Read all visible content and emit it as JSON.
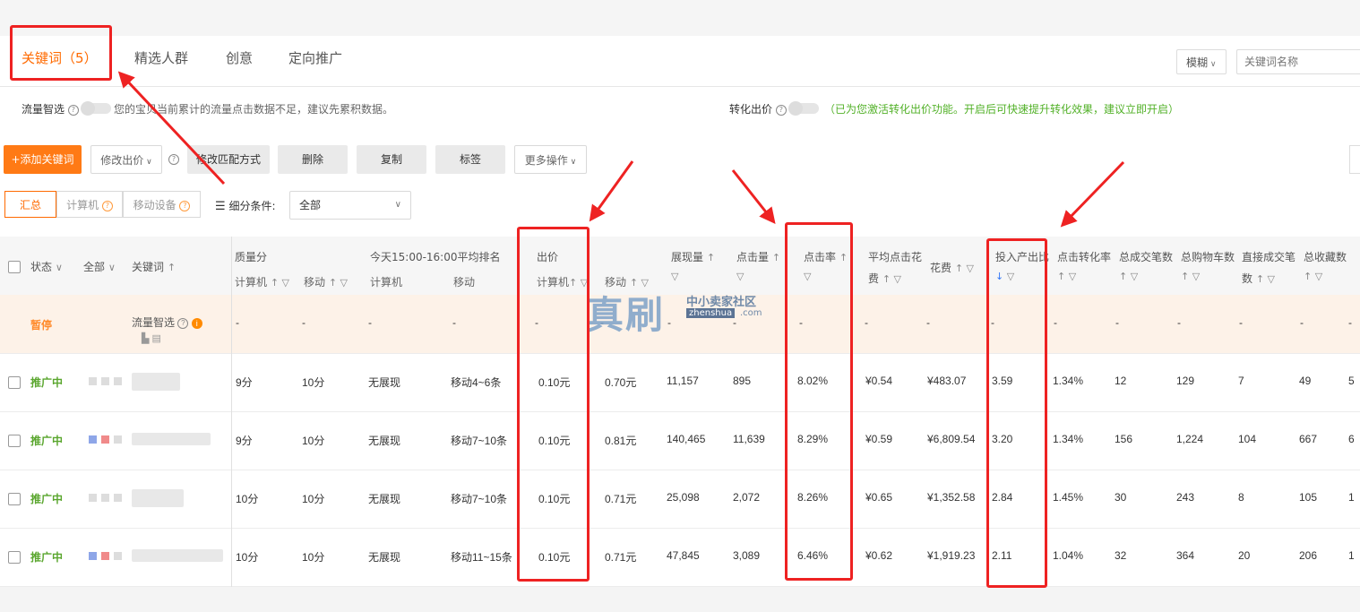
{
  "tabs": {
    "keywords_label": "关键词（",
    "keywords_count": "5",
    "keywords_close": "）",
    "crowd": "精选人群",
    "creative": "创意",
    "targeting": "定向推广"
  },
  "search": {
    "fuzzy": "模糊",
    "placeholder": "关键词名称"
  },
  "flow": {
    "label": "流量智选",
    "message": "您的宝贝当前累计的流量点击数据不足，建议先累积数据。",
    "conv_label": "转化出价",
    "conv_message": "（已为您激活转化出价功能。开启后可快速提升转化效果，建议立即开启）"
  },
  "actions": {
    "add": "+添加关键词",
    "modify_bid": "修改出价",
    "modify_match": "修改匹配方式",
    "delete": "删除",
    "copy": "复制",
    "tag": "标签",
    "more": "更多操作"
  },
  "segments": {
    "summary": "汇总",
    "pc": "计算机",
    "mobile": "移动设备",
    "subdiv_label": "细分条件:",
    "subdiv_value": "全部"
  },
  "headers": {
    "status": "状态",
    "all": "全部",
    "keyword": "关键词",
    "quality": "质量分",
    "pc": "计算机",
    "mobile": "移动",
    "rank": "今天15:00-16:00平均排名",
    "bid": "出价",
    "impressions": "展现量",
    "clicks": "点击量",
    "ctr": "点击率",
    "avg_cpc_1": "平均点击花",
    "avg_cpc_2": "费",
    "spend": "花费",
    "roi": "投入产出比",
    "cvr": "点击转化率",
    "orders": "总成交笔数",
    "cart": "总购物车数",
    "direct_1": "直接成交笔",
    "direct_2": "数",
    "fav": "总收藏数"
  },
  "paused_row": {
    "status": "暂停",
    "keyword": "流量智选",
    "dash": "-"
  },
  "rows": [
    {
      "status": "推广中",
      "quality_pc": "9分",
      "quality_mobile": "10分",
      "rank_pc": "无展现",
      "rank_mobile": "移动4~6条",
      "bid_pc": "0.10元",
      "bid_mobile": "0.70元",
      "impressions": "11,157",
      "clicks": "895",
      "ctr": "8.02%",
      "cpc": "¥0.54",
      "spend": "¥483.07",
      "roi": "3.59",
      "cvr": "1.34%",
      "orders": "12",
      "cart": "129",
      "direct": "7",
      "fav": "49",
      "extra": "5"
    },
    {
      "status": "推广中",
      "quality_pc": "9分",
      "quality_mobile": "10分",
      "rank_pc": "无展现",
      "rank_mobile": "移动7~10条",
      "bid_pc": "0.10元",
      "bid_mobile": "0.81元",
      "impressions": "140,465",
      "clicks": "11,639",
      "ctr": "8.29%",
      "cpc": "¥0.59",
      "spend": "¥6,809.54",
      "roi": "3.20",
      "cvr": "1.34%",
      "orders": "156",
      "cart": "1,224",
      "direct": "104",
      "fav": "667",
      "extra": "6"
    },
    {
      "status": "推广中",
      "quality_pc": "10分",
      "quality_mobile": "10分",
      "rank_pc": "无展现",
      "rank_mobile": "移动7~10条",
      "bid_pc": "0.10元",
      "bid_mobile": "0.71元",
      "impressions": "25,098",
      "clicks": "2,072",
      "ctr": "8.26%",
      "cpc": "¥0.65",
      "spend": "¥1,352.58",
      "roi": "2.84",
      "cvr": "1.45%",
      "orders": "30",
      "cart": "243",
      "direct": "8",
      "fav": "105",
      "extra": "1"
    },
    {
      "status": "推广中",
      "quality_pc": "10分",
      "quality_mobile": "10分",
      "rank_pc": "无展现",
      "rank_mobile": "移动11~15条",
      "bid_pc": "0.10元",
      "bid_mobile": "0.71元",
      "impressions": "47,845",
      "clicks": "3,089",
      "ctr": "6.46%",
      "cpc": "¥0.62",
      "spend": "¥1,919.23",
      "roi": "2.11",
      "cvr": "1.04%",
      "orders": "32",
      "cart": "364",
      "direct": "20",
      "fav": "206",
      "extra": "1"
    }
  ],
  "watermark": {
    "main": "真刷",
    "sub": "中小卖家社区",
    "url": "zhenshua",
    "com": ".com"
  },
  "colors": {
    "accent": "#ff6a00",
    "green": "#5aa62e",
    "annotation": "#ee2222"
  }
}
